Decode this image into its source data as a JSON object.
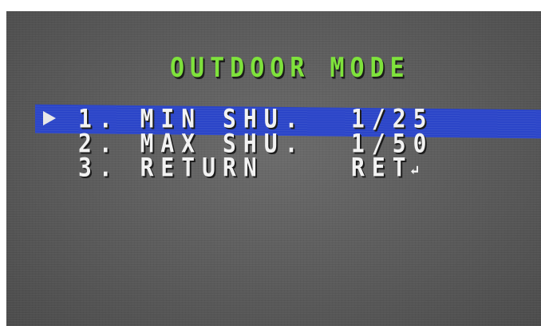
{
  "osd": {
    "title": "OUTDOOR MODE",
    "selected_index": 0,
    "cursor_icon": "triangle-right-icon",
    "items": [
      {
        "label": "1. MIN SHU.",
        "value": "1/25"
      },
      {
        "label": "2. MAX SHU.",
        "value": "1/50"
      },
      {
        "label": "3. RETURN",
        "value": "RET",
        "value_icon": "enter-return-icon"
      }
    ]
  },
  "colors": {
    "title": "#7fe23c",
    "highlight": "#2b45c8",
    "text": "#f2f2f2",
    "background": "#5e5e5e"
  }
}
